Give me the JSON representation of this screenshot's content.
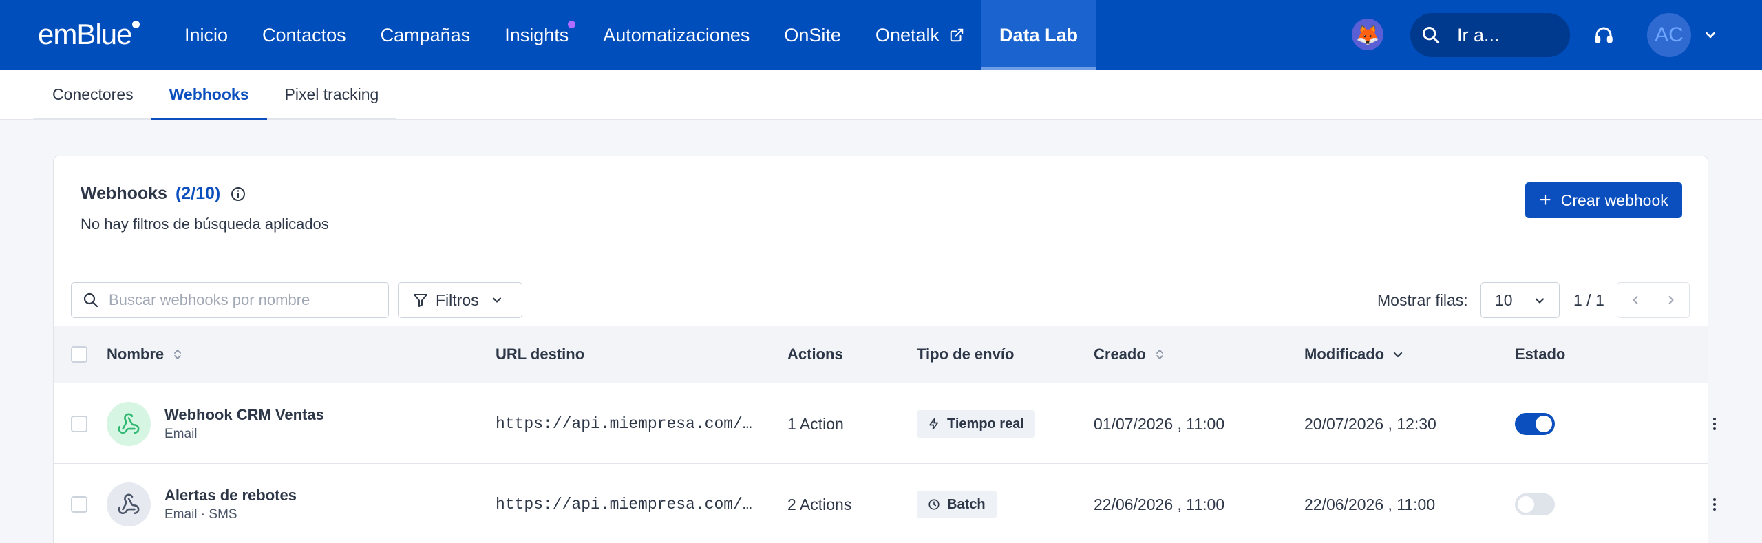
{
  "nav": {
    "logo": "emBlue",
    "items": [
      {
        "label": "Inicio"
      },
      {
        "label": "Contactos"
      },
      {
        "label": "Campañas"
      },
      {
        "label": "Insights"
      },
      {
        "label": "Automatizaciones"
      },
      {
        "label": "OnSite"
      },
      {
        "label": "Onetalk"
      },
      {
        "label": "Data Lab"
      }
    ],
    "search_label": "Ir a...",
    "user_initials": "AC",
    "insights_badge_color": "#b06bff",
    "bg_color": "#004dbc"
  },
  "subtabs": [
    {
      "label": "Conectores"
    },
    {
      "label": "Webhooks"
    },
    {
      "label": "Pixel tracking"
    }
  ],
  "card": {
    "title": "Webhooks",
    "count": "(2/10)",
    "subtitle": "No hay filtros de búsqueda aplicados",
    "create_label": "Crear webhook"
  },
  "toolbar": {
    "search_placeholder": "Buscar webhooks por nombre",
    "filter_label": "Filtros",
    "rows_label": "Mostrar filas:",
    "rows_value": "10",
    "page_info": "1 / 1"
  },
  "table": {
    "columns": [
      "Nombre",
      "URL destino",
      "Actions",
      "Tipo de envío",
      "Creado",
      "Modificado",
      "Estado"
    ],
    "rows": [
      {
        "name": "Webhook CRM Ventas",
        "channels": "Email",
        "url": "https://api.miempresa.com/…",
        "actions": "1 Action",
        "send_type": "Tiempo real",
        "created": "01/07/2026 , 11:00",
        "modified": "20/07/2026 , 12:30",
        "enabled": true
      },
      {
        "name": "Alertas de rebotes",
        "channels": "Email · SMS",
        "url": "https://api.miempresa.com/…",
        "actions": "2 Actions",
        "send_type": "Batch",
        "created": "22/06/2026 , 11:00",
        "modified": "22/06/2026 , 11:00",
        "enabled": false
      }
    ]
  },
  "colors": {
    "primary": "#0b4fbf",
    "toggle_on": "#0b4fbf",
    "toggle_off": "#dfe3ea"
  }
}
